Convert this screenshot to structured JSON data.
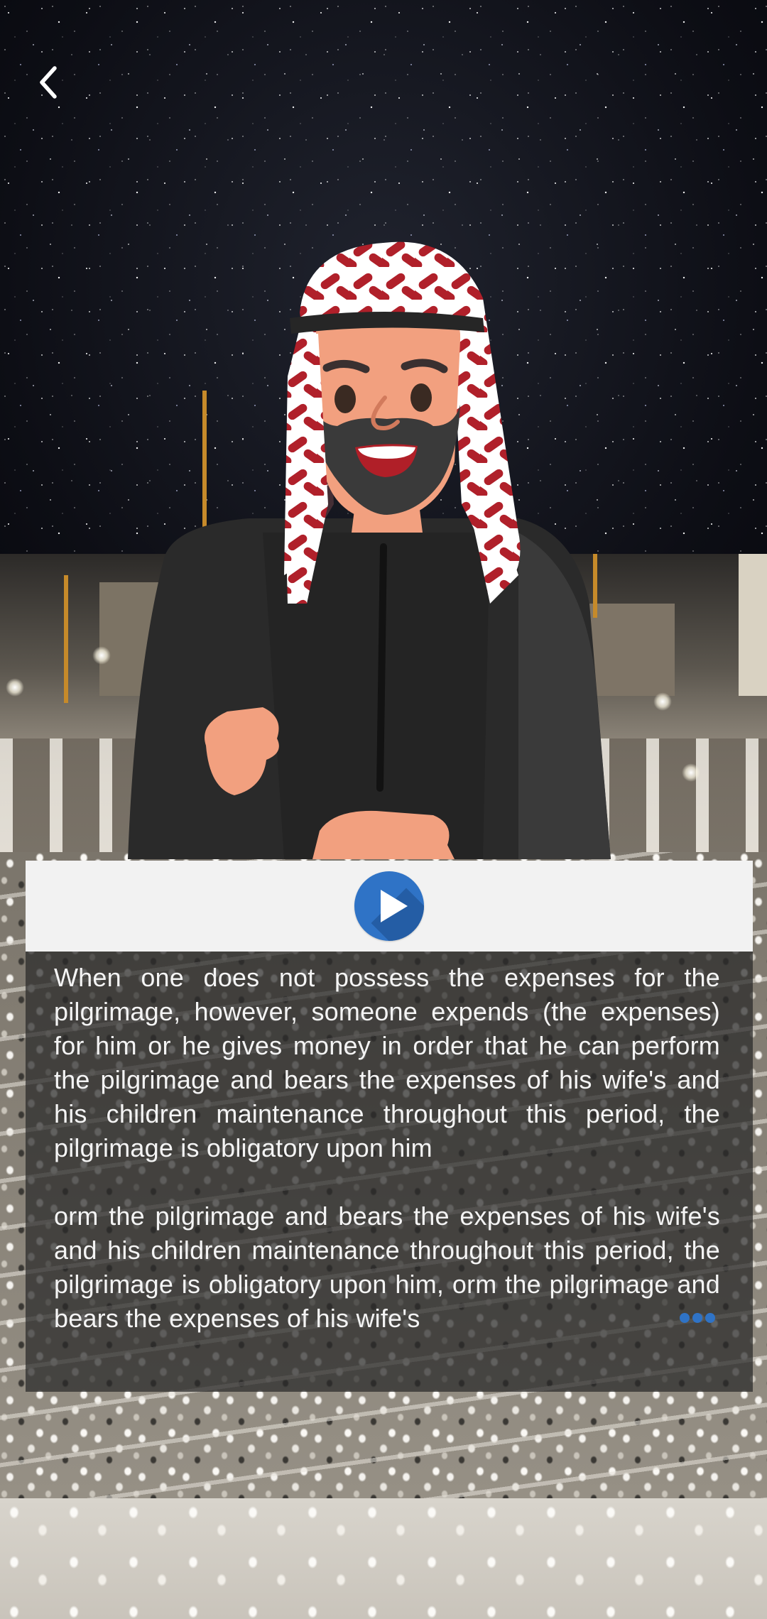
{
  "navigation": {
    "back_icon": "chevron-left-icon"
  },
  "scene": {
    "description_icon": "character-avatar"
  },
  "player": {
    "play_icon": "play-icon",
    "accent_color": "#2f73c6"
  },
  "content": {
    "paragraph_1": "When one does not possess the expenses for the pilgrimage, however, someone expends (the expenses) for him or he gives money in order that he can perform the pilgrimage and bears the expenses of his wife's and his children maintenance throughout this period, the pilgrimage is obligatory upon him",
    "paragraph_2": "orm the pilgrimage and bears the expenses of his wife's and his children maintenance throughout this period, the pilgrimage is obligatory upon him, orm the pilgrimage and bears the expenses of his wife's"
  },
  "loading_indicator": {
    "icon": "loading-dots-icon",
    "color": "#2f73c6"
  }
}
